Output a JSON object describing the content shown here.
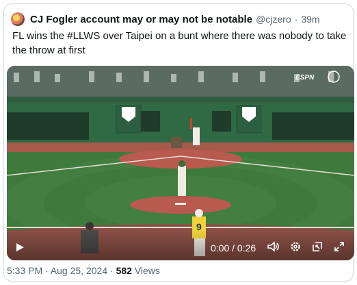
{
  "tweet": {
    "author_name": "CJ Fogler account may or may not be notable",
    "handle": "@cjzero",
    "separator": "·",
    "time": "39m",
    "text": "FL wins the #LLWS over Taipei on a bunt where there was nobody to take the throw at first"
  },
  "video": {
    "time_display": "0:00 / 0:26",
    "broadcast_logo": "ESPN",
    "player_number": "9",
    "icons": [
      "play-icon",
      "volume-icon",
      "settings-icon",
      "picture-in-picture-icon",
      "fullscreen-icon"
    ]
  },
  "meta": {
    "timestamp": "5:33 PM · Aug 25, 2024",
    "separator": "·",
    "views_count": "582",
    "views_label": "Views"
  },
  "colors": {
    "grass": "#3b6b3a",
    "dirt": "#b85a4e",
    "wall": "#2f6a45",
    "text_muted": "#536471"
  }
}
